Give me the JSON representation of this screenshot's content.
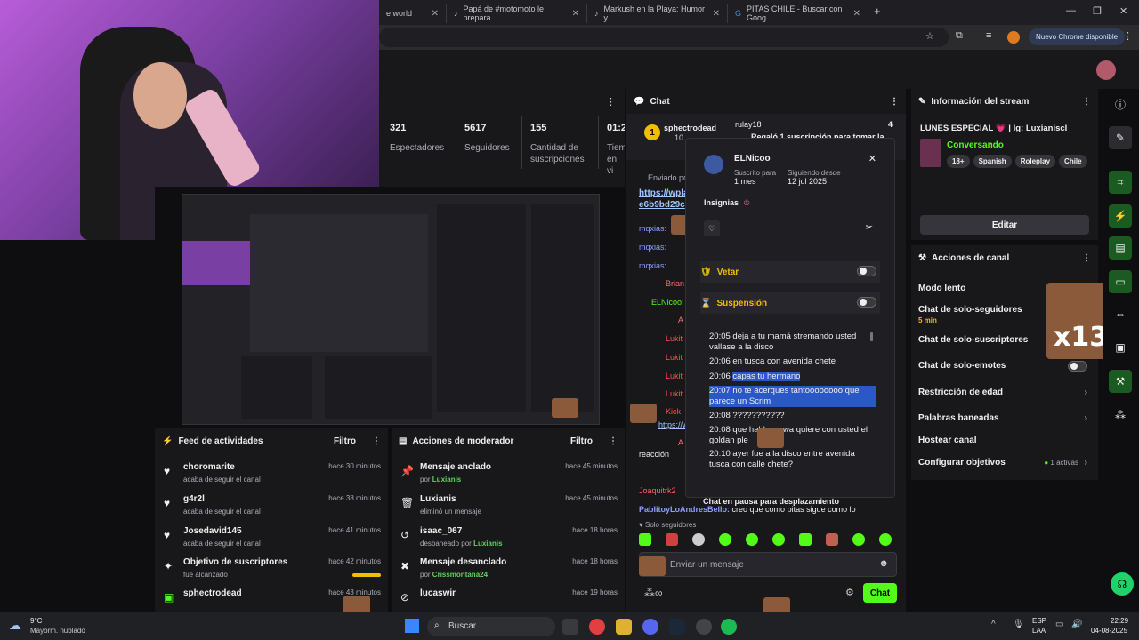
{
  "browser": {
    "tabs": [
      {
        "label": "e world"
      },
      {
        "label": "Papá de #motomoto le prepara"
      },
      {
        "label": "Markush en la Playa: Humor y"
      },
      {
        "label": "PITAS CHILE - Buscar con Goog"
      }
    ],
    "new_tab": "+",
    "chrome_update": "Nuevo Chrome disponible"
  },
  "stats": [
    {
      "value": "321",
      "label": "Espectadores"
    },
    {
      "value": "5617",
      "label": "Seguidores"
    },
    {
      "value": "155",
      "label": "Cantidad de suscripciones"
    },
    {
      "value": "01:2",
      "label": "Tiem en vi"
    }
  ],
  "activity_feed": {
    "title": "Feed de actividades",
    "filter": "Filtro",
    "items": [
      {
        "name": "choromarite",
        "desc": "acaba de seguir el canal",
        "time": "hace 30 minutos",
        "icon": "heart-icon"
      },
      {
        "name": "g4r2l",
        "desc": "acaba de seguir el canal",
        "time": "hace 38 minutos",
        "icon": "heart-icon"
      },
      {
        "name": "Josedavid145",
        "desc": "acaba de seguir el canal",
        "time": "hace 41 minutos",
        "icon": "heart-icon"
      },
      {
        "name": "Objetivo de suscriptores",
        "desc": "fue alcanzado",
        "time": "hace 42 minutos",
        "icon": "sparkle-icon"
      },
      {
        "name": "sphectrodead",
        "desc": "",
        "time": "hace 43 minutos",
        "icon": "sub-icon"
      }
    ]
  },
  "mod_actions": {
    "title": "Acciones de moderador",
    "filter": "Filtro",
    "items": [
      {
        "name": "Mensaje anclado",
        "prefix": "por ",
        "who": "Luxianis",
        "time": "hace 45 minutos",
        "icon": "pin-icon"
      },
      {
        "name": "Luxianis",
        "prefix": "eliminó un mensaje",
        "who": "",
        "time": "hace 45 minutos",
        "icon": "trash-icon"
      },
      {
        "name": "isaac_067",
        "prefix": "desbaneado por ",
        "who": "Luxianis",
        "time": "hace 18 horas",
        "icon": "undo-icon"
      },
      {
        "name": "Mensaje desanclado",
        "prefix": "por ",
        "who": "Crissmontana24",
        "time": "hace 18 horas",
        "icon": "unpin-icon"
      },
      {
        "name": "lucaswir",
        "prefix": "",
        "who": "",
        "time": "hace 19 horas",
        "icon": "ban-icon"
      }
    ]
  },
  "chat": {
    "title": "Chat",
    "pinned_user": "sphectrodead",
    "pinned_user2": "rulay18",
    "pinned_count": "4",
    "pinned_sub": "10",
    "pinned_msg": "Regaló 1 suscripción para tomar la",
    "sent_by": "Enviado po",
    "link": "https://wpla e6b9bd29c",
    "lines": [
      {
        "user": "mqxias:",
        "text": ""
      },
      {
        "user": "mqxias:",
        "text": ""
      },
      {
        "user": "mqxias:",
        "text": ""
      },
      {
        "user": "Brian",
        "text": ""
      },
      {
        "user": "ELNicoo:",
        "text": ""
      },
      {
        "user": "A",
        "text": ""
      },
      {
        "user": "Lukit",
        "text": ""
      },
      {
        "user": "Lukit",
        "text": ""
      },
      {
        "user": "Lukit",
        "text": ""
      },
      {
        "user": "Lukit",
        "text": ""
      },
      {
        "user": "Kick",
        "text": ""
      },
      {
        "user": "https://www",
        "text": ""
      },
      {
        "user": "A",
        "text": ""
      },
      {
        "user": "reacción",
        "text": ""
      },
      {
        "user": "Joaquitrk2",
        "text": ""
      }
    ],
    "paused": "Chat en pausa para desplazamiento",
    "last_line_user": "PablitoyLoAndresBello:",
    "last_line_text": "creo que como pitas sigue como lo",
    "followers_only": "Solo seguidores",
    "input_placeholder": "Enviar un mensaje",
    "send_button": "Chat"
  },
  "user_card": {
    "username": "ELNicoo",
    "sub_label": "Suscrito para",
    "sub_value": "1 mes",
    "follow_label": "Siguiendo desde",
    "follow_value": "12 jul 2025",
    "badges_label": "Insignias",
    "vetar": "Vetar",
    "suspension": "Suspensión",
    "messages": [
      {
        "time": "20:05",
        "text": "deja a tu mamá stremando usted vallase a la disco",
        "hl": false
      },
      {
        "time": "20:06",
        "text": "en tusca con avenida chete",
        "hl": false
      },
      {
        "time": "20:06",
        "text": "capas tu hermano",
        "hl": true
      },
      {
        "time": "20:07",
        "text": "no te acerques tantoooooooo que parece un Scrim",
        "hl": true
      },
      {
        "time": "20:08",
        "text": "???????????",
        "hl": false
      },
      {
        "time": "20:08",
        "text": "que hable wawa quiere con usted el goldan ple",
        "hl": false
      },
      {
        "time": "20:10",
        "text": "ayer fue a la disco entre avenida tusca con calle chete?",
        "hl": false
      }
    ]
  },
  "stream_info": {
    "title": "Información del stream",
    "stream_title": "LUNES ESPECIAL 💗 | Ig: Luxianiscl",
    "category": "Conversando",
    "tags": [
      "18+",
      "Spanish",
      "Roleplay",
      "Chile"
    ],
    "edit": "Editar"
  },
  "channel_actions": {
    "title": "Acciones de canal",
    "items": [
      {
        "label": "Modo lento",
        "sub": ""
      },
      {
        "label": "Chat de solo-seguidores",
        "sub": "5 min"
      },
      {
        "label": "Chat de solo-suscriptores",
        "sub": ""
      },
      {
        "label": "Chat de solo-emotes",
        "sub": ""
      },
      {
        "label": "Restricción de edad",
        "sub": ""
      },
      {
        "label": "Palabras baneadas",
        "sub": ""
      },
      {
        "label": "Hostear canal",
        "sub": ""
      },
      {
        "label": "Configurar objetivos",
        "sub": ""
      }
    ],
    "goals_active": "1 activas"
  },
  "emote_overlay": {
    "x13": "x13"
  },
  "taskbar": {
    "weather_temp": "9°C",
    "weather_desc": "Mayorm. nublado",
    "search": "Buscar",
    "lang1": "ESP",
    "lang2": "LAA",
    "time": "22:29",
    "date": "04-08-2025"
  },
  "colors": {
    "accent": "#53fc18",
    "bg": "#18181b"
  }
}
